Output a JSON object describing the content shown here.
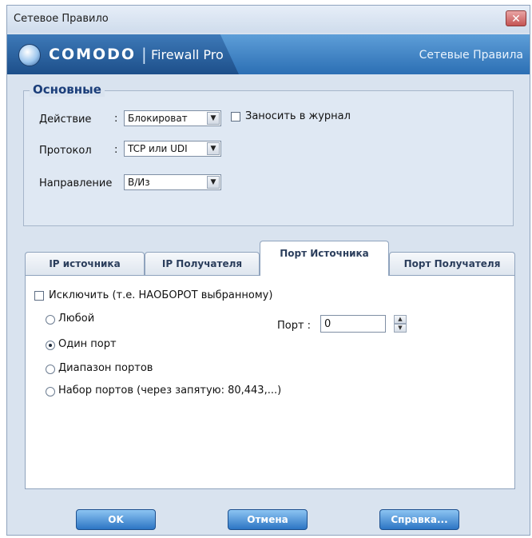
{
  "window": {
    "title": "Сетевое Правило",
    "close_glyph": "✕"
  },
  "banner": {
    "brand": "COMODO",
    "separator": "|",
    "product": "Firewall Pro",
    "section": "Сетевые Правила"
  },
  "basic": {
    "title": "Основные",
    "action_label": "Действие",
    "action_colon": ":",
    "action_value": "Блокироват",
    "log_label": "Заносить в журнал",
    "log_checked": false,
    "protocol_label": "Протокол",
    "protocol_colon": ":",
    "protocol_value": "TCP или UDI",
    "direction_label": "Направление",
    "direction_value": "В/Из"
  },
  "tabs": [
    {
      "label": "IP источника",
      "active": false
    },
    {
      "label": "IP Получателя",
      "active": false
    },
    {
      "label": "Порт Источника",
      "active": true
    },
    {
      "label": "Порт Получателя",
      "active": false
    }
  ],
  "port_panel": {
    "exclude_label": "Исключить (т.е. НАОБОРОТ выбранному)",
    "exclude_checked": false,
    "options": [
      {
        "label": "Любой",
        "checked": false
      },
      {
        "label": "Один порт",
        "checked": true
      },
      {
        "label": "Диапазон портов",
        "checked": false
      },
      {
        "label": "Набор портов (через запятую: 80,443,...)",
        "checked": false
      }
    ],
    "port_label": "Порт :",
    "port_value": "0"
  },
  "buttons": {
    "ok": "OK",
    "cancel": "Отмена",
    "help": "Справка..."
  },
  "icons": {
    "dropdown": "▼",
    "spin_up": "▲",
    "spin_down": "▼",
    "logo": "comodo-shield-icon"
  }
}
